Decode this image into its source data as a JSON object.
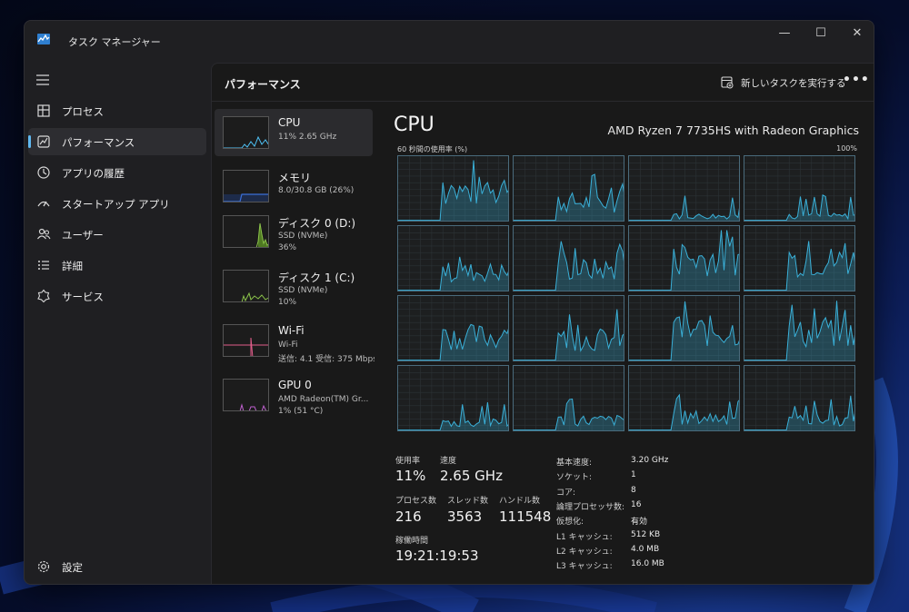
{
  "window": {
    "title": "タスク マネージャー"
  },
  "window_controls": {
    "minimize": "—",
    "maximize": "☐",
    "close": "✕"
  },
  "sidebar": {
    "items": [
      {
        "label": "プロセス",
        "icon": "processes-icon"
      },
      {
        "label": "パフォーマンス",
        "icon": "performance-icon",
        "active": true
      },
      {
        "label": "アプリの履歴",
        "icon": "history-icon"
      },
      {
        "label": "スタートアップ アプリ",
        "icon": "startup-icon"
      },
      {
        "label": "ユーザー",
        "icon": "users-icon"
      },
      {
        "label": "詳細",
        "icon": "details-icon"
      },
      {
        "label": "サービス",
        "icon": "services-icon"
      }
    ],
    "settings_label": "設定"
  },
  "header": {
    "title": "パフォーマンス",
    "run_task_label": "新しいタスクを実行する",
    "more_label": "•••"
  },
  "devices": [
    {
      "name": "CPU",
      "line1": "11%  2.65 GHz",
      "line2": "",
      "line3": "",
      "color": "#4fc3f7"
    },
    {
      "name": "メモリ",
      "line1": "8.0/30.8 GB (26%)",
      "line2": "",
      "line3": "",
      "color": "#3b6fd8"
    },
    {
      "name": "ディスク 0 (D:)",
      "line1": "SSD (NVMe)",
      "line2": "36%",
      "line3": "",
      "color": "#8bc34a"
    },
    {
      "name": "ディスク 1 (C:)",
      "line1": "SSD (NVMe)",
      "line2": "10%",
      "line3": "",
      "color": "#8bc34a"
    },
    {
      "name": "Wi-Fi",
      "line1": "Wi-Fi",
      "line2": "送信: 4.1  受信: 375 Mbps",
      "line3": "",
      "color": "#e05d8a"
    },
    {
      "name": "GPU 0",
      "line1": "AMD Radeon(TM) Gr...",
      "line2": "1% (51 °C)",
      "line3": "",
      "color": "#c060d0"
    }
  ],
  "cpu": {
    "title": "CPU",
    "model": "AMD Ryzen 7 7735HS with Radeon Graphics",
    "graph_caption_left": "60 秒間の使用率 (%)",
    "graph_caption_right": "100%",
    "stats": {
      "usage_label": "使用率",
      "usage_value": "11%",
      "speed_label": "速度",
      "speed_value": "2.65 GHz",
      "processes_label": "プロセス数",
      "processes_value": "216",
      "threads_label": "スレッド数",
      "threads_value": "3563",
      "handles_label": "ハンドル数",
      "handles_value": "111548",
      "uptime_label": "稼働時間",
      "uptime_value": "19:21:19:53"
    },
    "specs": [
      {
        "key": "基本速度:",
        "value": "3.20 GHz"
      },
      {
        "key": "ソケット:",
        "value": "1"
      },
      {
        "key": "コア:",
        "value": "8"
      },
      {
        "key": "論理プロセッサ数:",
        "value": "16"
      },
      {
        "key": "仮想化:",
        "value": "有効"
      },
      {
        "key": "L1 キャッシュ:",
        "value": "512 KB"
      },
      {
        "key": "L2 キャッシュ:",
        "value": "4.0 MB"
      },
      {
        "key": "L3 キャッシュ:",
        "value": "16.0 MB"
      }
    ],
    "core_graph_color": "#3ab0d8",
    "core_count": 16
  }
}
